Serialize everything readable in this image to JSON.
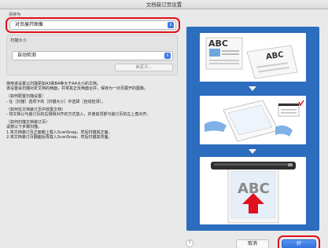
{
  "window": {
    "title": "文档装订页设置"
  },
  "save_as": {
    "label": "另存为",
    "selected": "对页展开图像"
  },
  "scan_size": {
    "label": "扫描大小",
    "selected": "自动检测",
    "custom_button": "自定义..."
  },
  "description": {
    "intro1": "使用该设置以扫描更如A3和B4等大于A4大小的文档。",
    "intro2": "该设置会扫描对折文档的两面，并将其正反两面合并，保存为一对页展开的图像。",
    "h1": "（如何配置扫描设置）",
    "l1": "- 在［扫描］选项卡的［扫描大小］中选择［自动检测］。",
    "h2": "（如何在文档装订页中放置文档）",
    "l2": "- 将文档以与装订页的右侧相对齐的方式放入，并使其顶部与装订页的左上角对齐。",
    "h3": "（如何扫描文档装订页）",
    "l3": "请按以下步骤扫描。",
    "l4": "1.将文档装订页正面朝上载入ScanSnap，然后扫描其正面。",
    "l5": "2.将文档装订页翻面后再载入ScanSnap，然后扫描其背面。"
  },
  "illustration": {
    "doc1": "ABC",
    "doc2": "ABC",
    "doc3": "ABC"
  },
  "footer": {
    "help": "?",
    "cancel": "取消",
    "ok": "好"
  },
  "colors": {
    "panel": "#2c6dbd",
    "highlight": "#e0101c",
    "accent": "#3b7be8"
  }
}
